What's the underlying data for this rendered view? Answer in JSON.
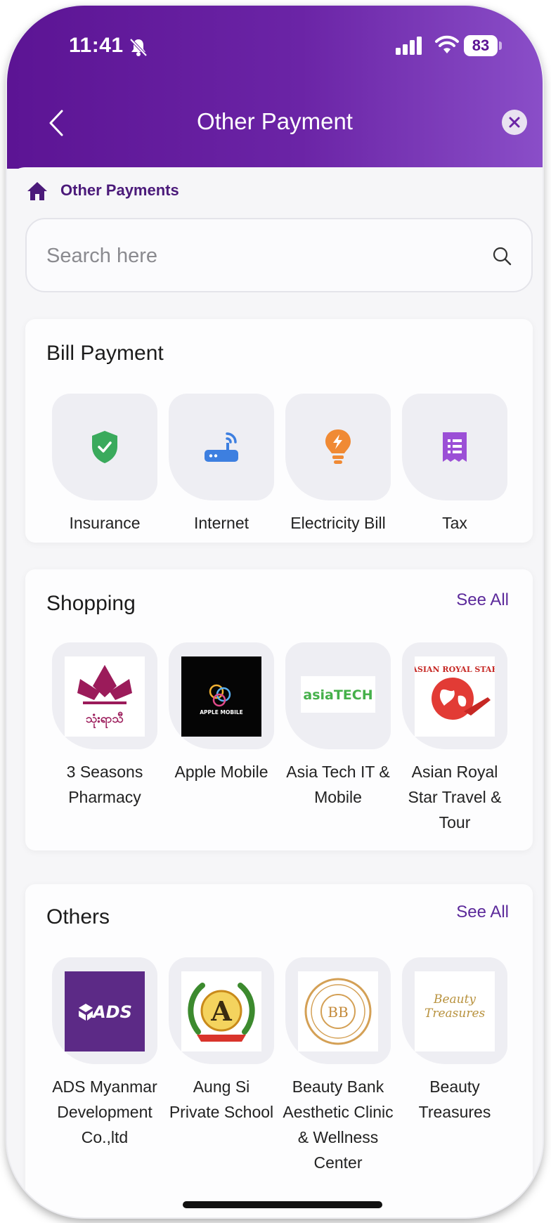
{
  "status_bar": {
    "time": "11:41",
    "battery": "83"
  },
  "header": {
    "title": "Other Payment"
  },
  "breadcrumb": {
    "label": "Other Payments"
  },
  "search": {
    "placeholder": "Search here"
  },
  "bill_payment": {
    "title": "Bill Payment",
    "items": [
      {
        "label": "Insurance",
        "icon": "shield-check-icon",
        "color": "#3aaa5c"
      },
      {
        "label": "Internet",
        "icon": "router-icon",
        "color": "#3d7fe0"
      },
      {
        "label": "Electricity Bill",
        "icon": "lightbulb-icon",
        "color": "#f08a34"
      },
      {
        "label": "Tax",
        "icon": "receipt-icon",
        "color": "#9b4fd6"
      }
    ]
  },
  "shopping": {
    "title": "Shopping",
    "see_all": "See All",
    "items": [
      {
        "label": "3 Seasons Pharmacy",
        "logo_text": "သုံးရာသီ"
      },
      {
        "label": "Apple Mobile",
        "logo_text": "APPLE MOBILE"
      },
      {
        "label": "Asia Tech IT & Mobile",
        "logo_text": "asiaTECH"
      },
      {
        "label": "Asian Royal Star Travel & Tour",
        "logo_text": "ASIAN ROYAL STAR"
      }
    ]
  },
  "others": {
    "title": "Others",
    "see_all": "See All",
    "items": [
      {
        "label": "ADS Myanmar Development Co.,ltd",
        "logo_text": "ADS"
      },
      {
        "label": "Aung Si Private School",
        "logo_text": "A"
      },
      {
        "label": "Beauty Bank Aesthetic Clinic & Wellness Center",
        "logo_text": "BB"
      },
      {
        "label": "Beauty Treasures",
        "logo_text": "Beauty Treasures"
      }
    ]
  },
  "colors": {
    "header_start": "#5c1494",
    "header_end": "#8a4ec8",
    "accent": "#5c2a9b"
  }
}
